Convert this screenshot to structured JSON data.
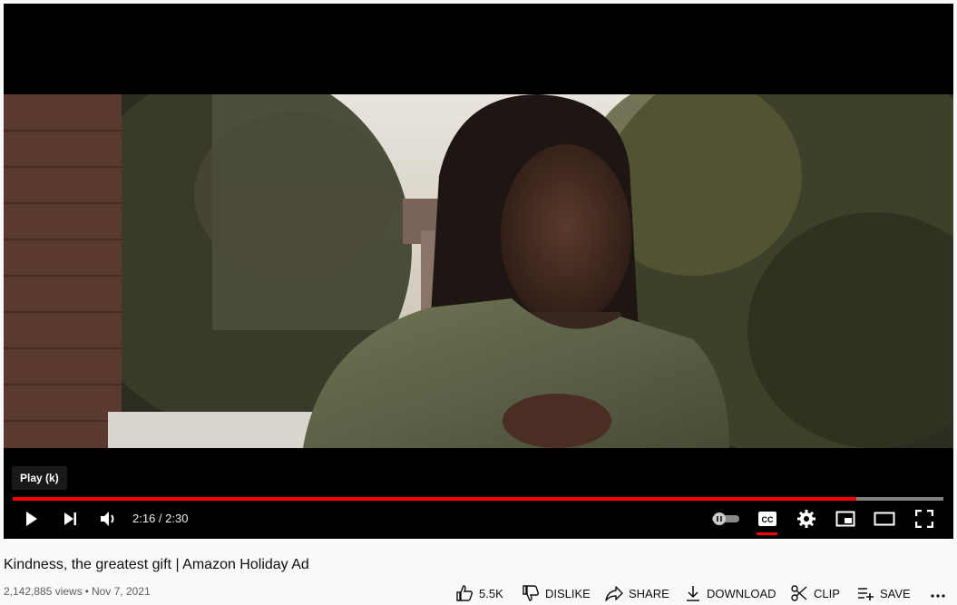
{
  "player": {
    "tooltip": "Play (k)",
    "time_display": "2:16 / 2:30",
    "progress": 0.906,
    "buffered": 1.0,
    "accent_color": "#ff0000",
    "controls": [
      "play-icon",
      "next-icon",
      "volume-icon",
      "autoplay-toggle",
      "subtitles-icon",
      "settings-icon",
      "miniplayer-icon",
      "theater-icon",
      "fullscreen-icon"
    ]
  },
  "video": {
    "title": "Kindness, the greatest gift | Amazon Holiday Ad",
    "views": "2,142,885 views",
    "separator": "•",
    "date": "Nov 7, 2021"
  },
  "actions": {
    "like_count": "5.5K",
    "dislike_label": "DISLIKE",
    "share_label": "SHARE",
    "download_label": "DOWNLOAD",
    "clip_label": "CLIP",
    "save_label": "SAVE"
  }
}
